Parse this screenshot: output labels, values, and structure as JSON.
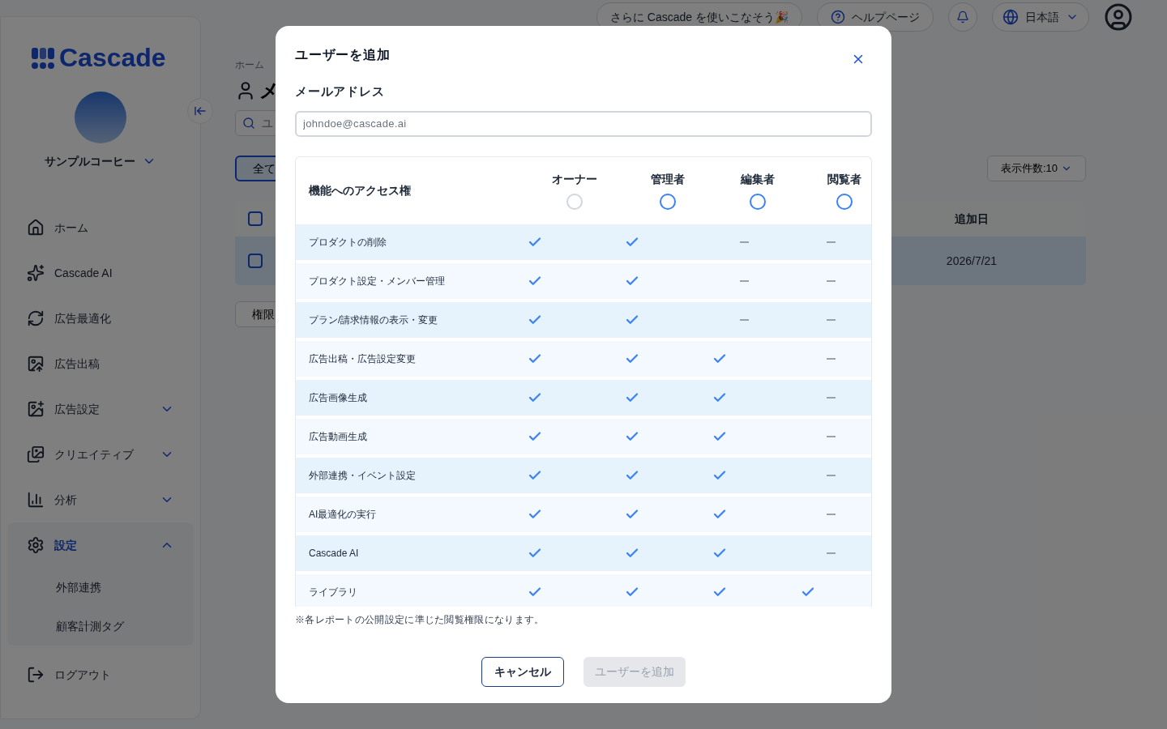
{
  "sidebar": {
    "logo": "Cascade",
    "account": "サンプルコーヒー",
    "items": [
      {
        "label": "ホーム",
        "active": false
      },
      {
        "label": "Cascade AI",
        "active": false
      },
      {
        "label": "広告最適化",
        "active": false
      },
      {
        "label": "広告出稿",
        "active": false
      },
      {
        "label": "広告設定",
        "active": false,
        "expanded": false
      },
      {
        "label": "クリエイティブ",
        "active": false,
        "expanded": false
      },
      {
        "label": "分析",
        "active": false,
        "expanded": false
      },
      {
        "label": "設定",
        "active": true,
        "expanded": true,
        "children": [
          {
            "label": "外部連携"
          },
          {
            "label": "顧客計測タグ"
          }
        ]
      }
    ],
    "logout": "ログアウト"
  },
  "top_bar": {
    "promo": "さらに Cascade を使いこなそう🎉",
    "help": "ヘルプページ",
    "language": "日本語"
  },
  "page": {
    "breadcrumb": "ホーム",
    "title": "メ",
    "search_placeholder": "ユ",
    "filter_tab": "全て",
    "permission_button": "権限",
    "page_size": "表示件数:10",
    "date_column": "追加日",
    "header_checked": false,
    "rows": [
      {
        "checked": false,
        "date": "2026/7/21"
      }
    ]
  },
  "dialog": {
    "title": "ユーザーを追加",
    "email_label": "メールアドレス",
    "email_placeholder": "johndoe@cascade.ai",
    "table_heading": "機能へのアクセス権",
    "roles": [
      {
        "label": "オーナー",
        "selected": false,
        "disabled": true
      },
      {
        "label": "管理者",
        "selected": false,
        "disabled": false
      },
      {
        "label": "編集者",
        "selected": false,
        "disabled": false
      },
      {
        "label": "閲覧者",
        "selected": false,
        "disabled": false
      }
    ],
    "rows": [
      {
        "feature": "プロダクトの削除",
        "allowed": [
          true,
          true,
          false,
          false
        ]
      },
      {
        "feature": "プロダクト設定・メンバー管理",
        "allowed": [
          true,
          true,
          false,
          false
        ]
      },
      {
        "feature": "プラン/請求情報の表示・変更",
        "allowed": [
          true,
          true,
          false,
          false
        ]
      },
      {
        "feature": "広告出稿・広告設定変更",
        "allowed": [
          true,
          true,
          true,
          false
        ]
      },
      {
        "feature": "広告画像生成",
        "allowed": [
          true,
          true,
          true,
          false
        ]
      },
      {
        "feature": "広告動画生成",
        "allowed": [
          true,
          true,
          true,
          false
        ]
      },
      {
        "feature": "外部連携・イベント設定",
        "allowed": [
          true,
          true,
          true,
          false
        ]
      },
      {
        "feature": "AI最適化の実行",
        "allowed": [
          true,
          true,
          true,
          false
        ]
      },
      {
        "feature": "Cascade AI",
        "allowed": [
          true,
          true,
          true,
          false
        ]
      },
      {
        "feature": "ライブラリ",
        "allowed": [
          true,
          true,
          true,
          true
        ]
      }
    ],
    "note": "※各レポートの公開設定に準じた閲覧権限になります。",
    "cancel": "キャンセル",
    "submit": {
      "label": "ユーザーを追加",
      "disabled": true
    }
  }
}
